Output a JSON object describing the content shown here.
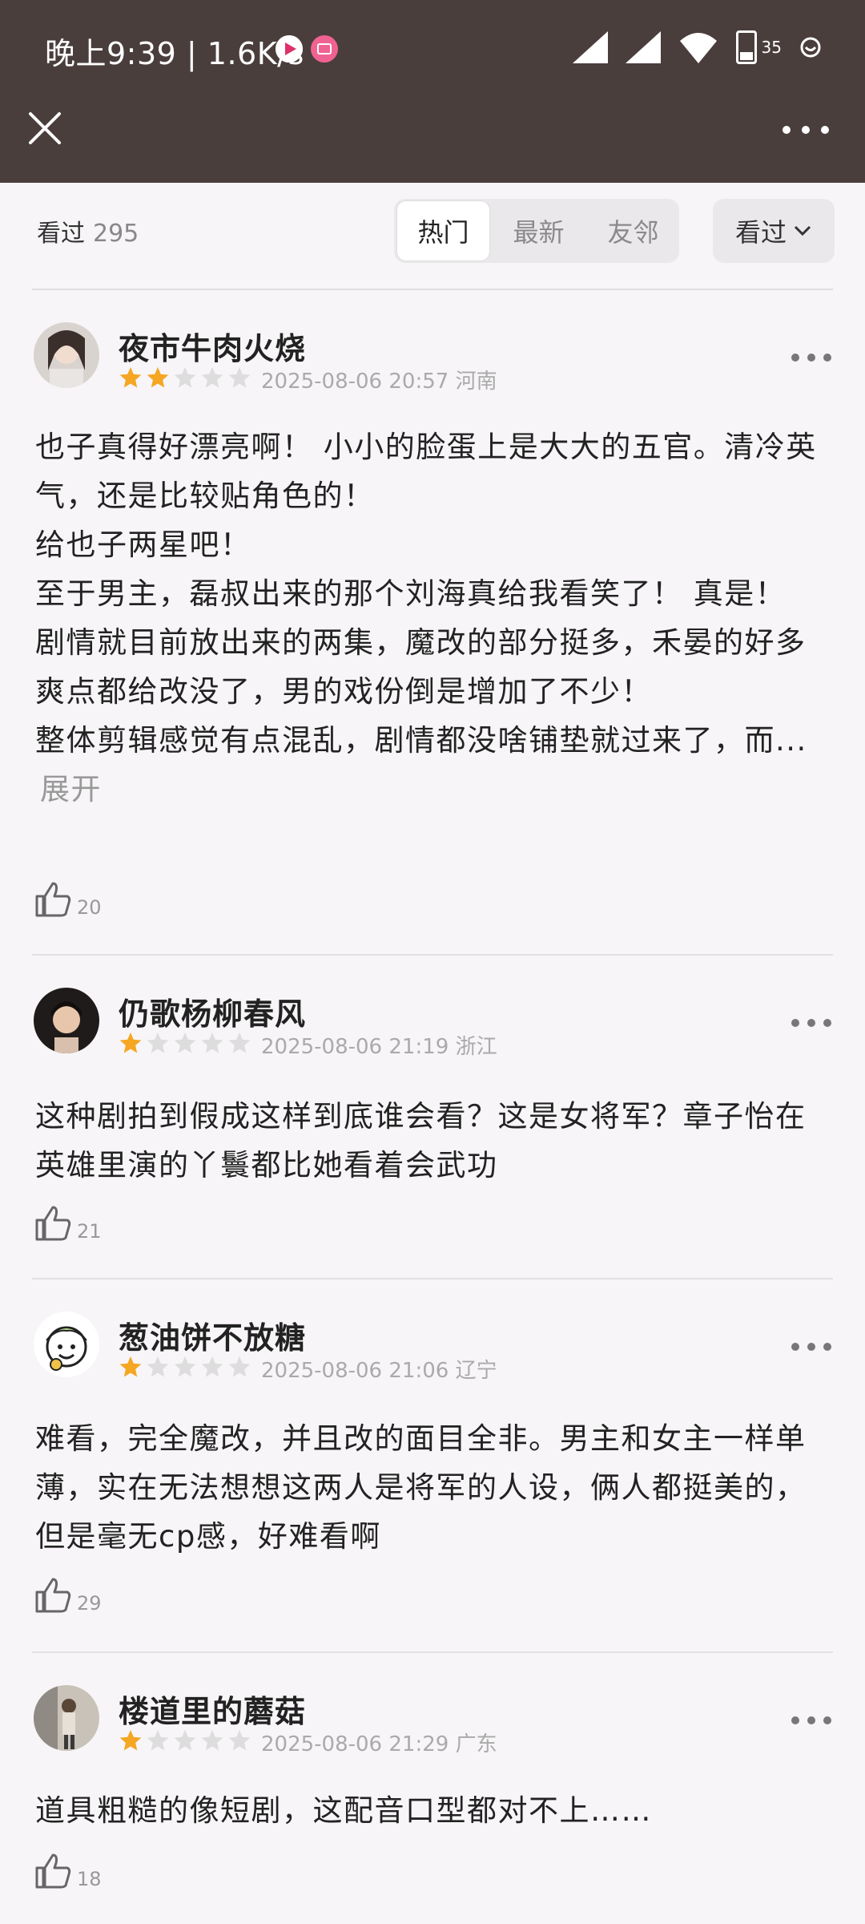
{
  "status_bar": {
    "time": "晚上9:39 | 1.6K/s",
    "battery": "35"
  },
  "header": {
    "seen_label": "看过",
    "seen_count": "295",
    "tabs": [
      {
        "label": "热门",
        "active": true
      },
      {
        "label": "最新",
        "active": false
      },
      {
        "label": "友邻",
        "active": false
      }
    ],
    "filter_label": "看过"
  },
  "reviews": [
    {
      "username": "夜市牛肉火烧",
      "rating": 2,
      "date": "2025-08-06 20:57",
      "location": "河南",
      "paragraphs": [
        "也子真得好漂亮啊！ 小小的脸蛋上是大大的五官。清冷英气，还是比较贴角色的！",
        "给也子两星吧！",
        "至于男主，磊叔出来的那个刘海真给我看笑了！ 真是！",
        "剧情就目前放出来的两集，魔改的部分挺多，禾晏的好多爽点都给改没了，男的戏份倒是增加了不少！",
        "整体剪辑感觉有点混乱，剧情都没啥铺垫就过来了，而..."
      ],
      "expand_label": "展开",
      "likes": "20"
    },
    {
      "username": "仍歌杨柳春风",
      "rating": 1,
      "date": "2025-08-06 21:19",
      "location": "浙江",
      "paragraphs": [
        "这种剧拍到假成这样到底谁会看？这是女将军？章子怡在英雄里演的丫鬟都比她看着会武功"
      ],
      "likes": "21"
    },
    {
      "username": "葱油饼不放糖",
      "rating": 1,
      "date": "2025-08-06 21:06",
      "location": "辽宁",
      "paragraphs": [
        "难看，完全魔改，并且改的面目全非。男主和女主一样单薄，实在无法想想这两人是将军的人设，俩人都挺美的，但是毫无cp感，好难看啊"
      ],
      "likes": "29"
    },
    {
      "username": "楼道里的蘑菇",
      "rating": 1,
      "date": "2025-08-06 21:29",
      "location": "广东",
      "paragraphs": [
        "道具粗糙的像短剧，这配音口型都对不上……"
      ],
      "likes": "18"
    }
  ],
  "colors": {
    "topbar": "#4a3e3d",
    "star_filled": "#f5a623",
    "star_empty": "#dddddd",
    "background": "#f7f5f7"
  }
}
